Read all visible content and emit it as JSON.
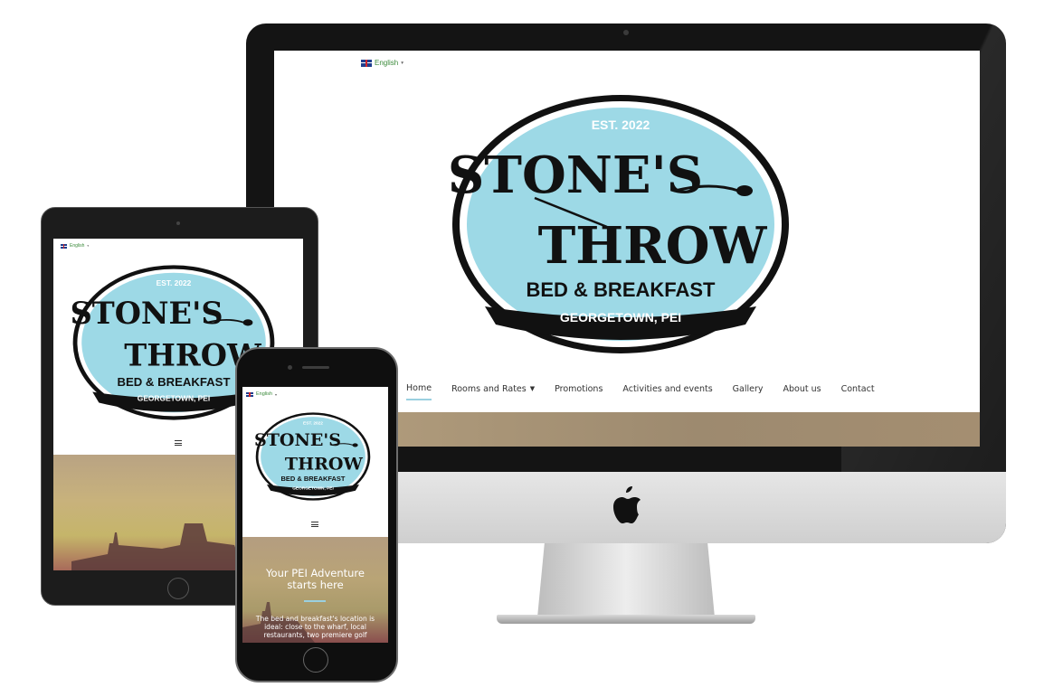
{
  "brand": {
    "established": "EST. 2022",
    "name_line1": "STONE'S",
    "name_line2": "THROW",
    "tagline": "BED & BREAKFAST",
    "location": "GEORGETOWN, PEI"
  },
  "language": {
    "selected": "English",
    "icon": "uk-flag-icon"
  },
  "nav": {
    "items": [
      {
        "label": "Home",
        "active": true
      },
      {
        "label": "Rooms and Rates",
        "has_dropdown": true
      },
      {
        "label": "Promotions"
      },
      {
        "label": "Activities and events"
      },
      {
        "label": "Gallery"
      },
      {
        "label": "About us"
      },
      {
        "label": "Contact"
      }
    ],
    "dropdown_icon": "caret-down-icon",
    "mobile_menu_icon": "hamburger-menu-icon"
  },
  "hero": {
    "heading": "Your PEI Adventure starts here",
    "body": "The bed and breakfast's location is ideal: close to the wharf, local restaurants, two premiere golf"
  },
  "colors": {
    "logo_fill": "#9dd9e6",
    "logo_outline": "#111111",
    "nav_active_underline": "#9ad0e0",
    "language_text": "#3a8a3a",
    "hero_sky": "#b7a27c"
  },
  "devices": [
    "imac",
    "ipad",
    "iphone"
  ]
}
